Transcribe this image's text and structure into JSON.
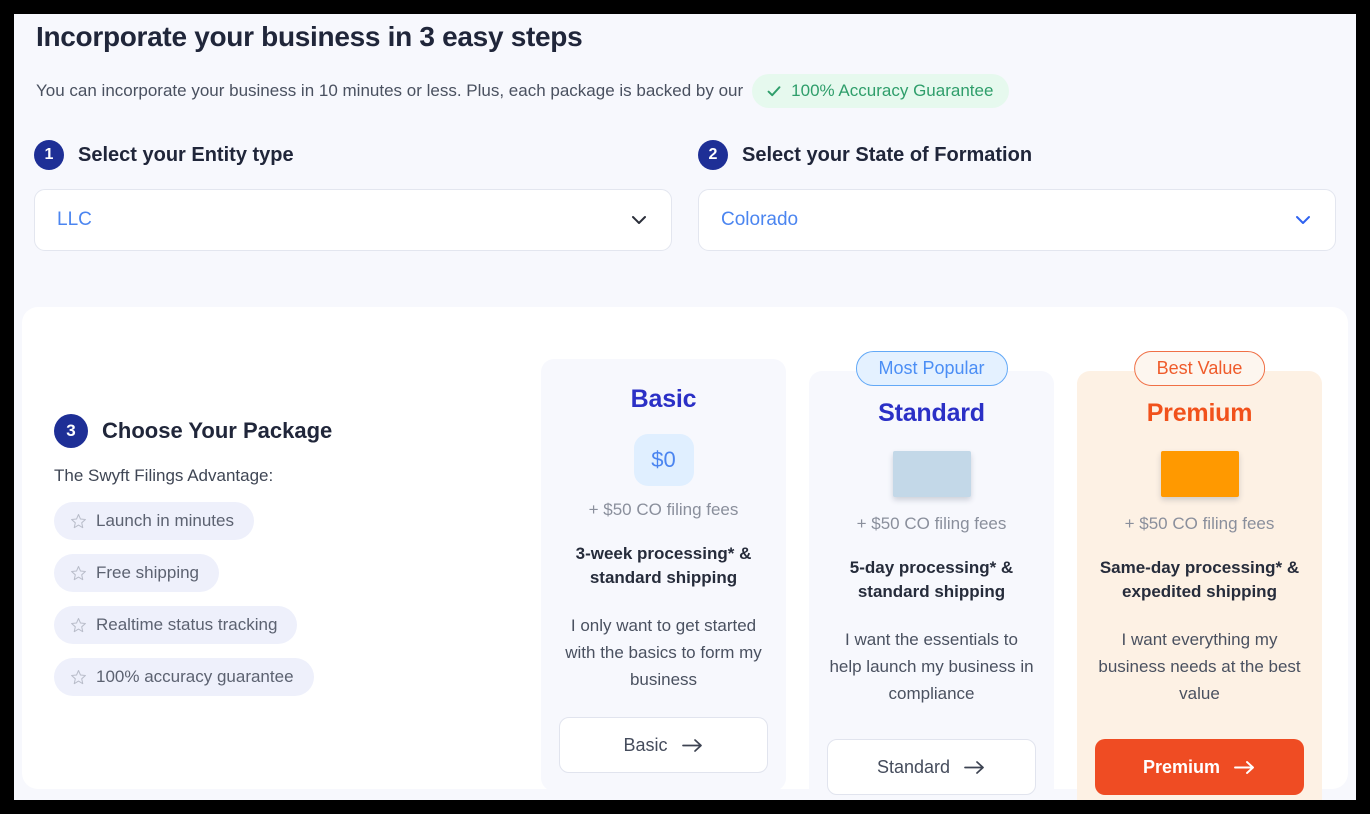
{
  "header": {
    "title": "Incorporate your business in 3 easy steps",
    "subtitle": "You can incorporate your business in 10 minutes or less. Plus, each package is backed by our",
    "guarantee_badge": "100% Accuracy Guarantee",
    "guarantee_icon": "check-icon"
  },
  "steps": [
    {
      "number": "1",
      "label": "Select your Entity type",
      "selected_value": "LLC",
      "chevron_icon": "chevron-down-icon",
      "chevron_color": "#2b2f3a"
    },
    {
      "number": "2",
      "label": "Select your State of Formation",
      "selected_value": "Colorado",
      "chevron_icon": "chevron-down-icon",
      "chevron_color": "#2f62f0"
    }
  ],
  "advantage": {
    "number": "3",
    "title": "Choose Your Package",
    "subtitle": "The Swyft Filings Advantage:",
    "items": [
      {
        "label": "Launch in minutes",
        "icon": "star-icon"
      },
      {
        "label": "Free shipping",
        "icon": "star-icon"
      },
      {
        "label": "Realtime status tracking",
        "icon": "star-icon"
      },
      {
        "label": "100% accuracy guarantee",
        "icon": "star-icon"
      }
    ]
  },
  "plans": [
    {
      "ribbon": "",
      "title": "Basic",
      "price": "$0",
      "price_state": "value",
      "fees": "+ $50 CO filing fees",
      "processing": "3-week processing* & standard shipping",
      "blurb": "I only want to get started with the basics to form my business",
      "cta_label": "Basic",
      "cta_icon": "arrow-right-icon"
    },
    {
      "ribbon": "Most Popular",
      "title": "Standard",
      "price": "",
      "price_state": "loading",
      "fees": "+ $50 CO filing fees",
      "processing": "5-day processing* & standard shipping",
      "blurb": "I want the essentials to help launch my business in compliance",
      "cta_label": "Standard",
      "cta_icon": "arrow-right-icon"
    },
    {
      "ribbon": "Best Value",
      "title": "Premium",
      "price": "",
      "price_state": "loading",
      "fees": "+ $50 CO filing fees",
      "processing": "Same-day processing* & expedited shipping",
      "blurb": "I want everything my business needs at the best value",
      "cta_label": "Premium",
      "cta_icon": "arrow-right-icon"
    }
  ],
  "colors": {
    "step_badge": "#1e2f96",
    "accent_blue": "#2b30c6",
    "accent_orange": "#f1511b",
    "cta_orange": "#ef4c23",
    "guarantee_green": "#2f9e6b",
    "placeholder_blue": "#c3d8e8",
    "placeholder_orange": "#ff9900"
  }
}
